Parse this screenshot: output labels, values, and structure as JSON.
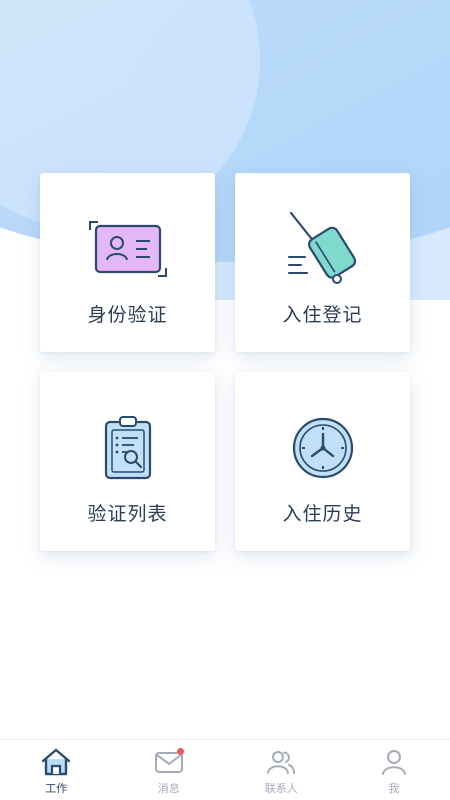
{
  "colors": {
    "hero_light": "#c7e0fb",
    "hero_mid": "#a9d0f8",
    "tab_active": "#2c4a6d",
    "tab_inactive": "#a6abb8",
    "badge": "#ef5b5b"
  },
  "cards": [
    {
      "label": "身份验证",
      "icon": "id-card-icon"
    },
    {
      "label": "入住登记",
      "icon": "luggage-icon"
    },
    {
      "label": "验证列表",
      "icon": "clipboard-search-icon"
    },
    {
      "label": "入住历史",
      "icon": "clock-icon"
    }
  ],
  "tabbar": {
    "items": [
      {
        "label": "工作",
        "icon": "home-icon",
        "active": true
      },
      {
        "label": "消息",
        "icon": "mail-icon",
        "badge": true
      },
      {
        "label": "联系人",
        "icon": "contacts-icon"
      },
      {
        "label": "我",
        "icon": "user-icon"
      }
    ]
  }
}
